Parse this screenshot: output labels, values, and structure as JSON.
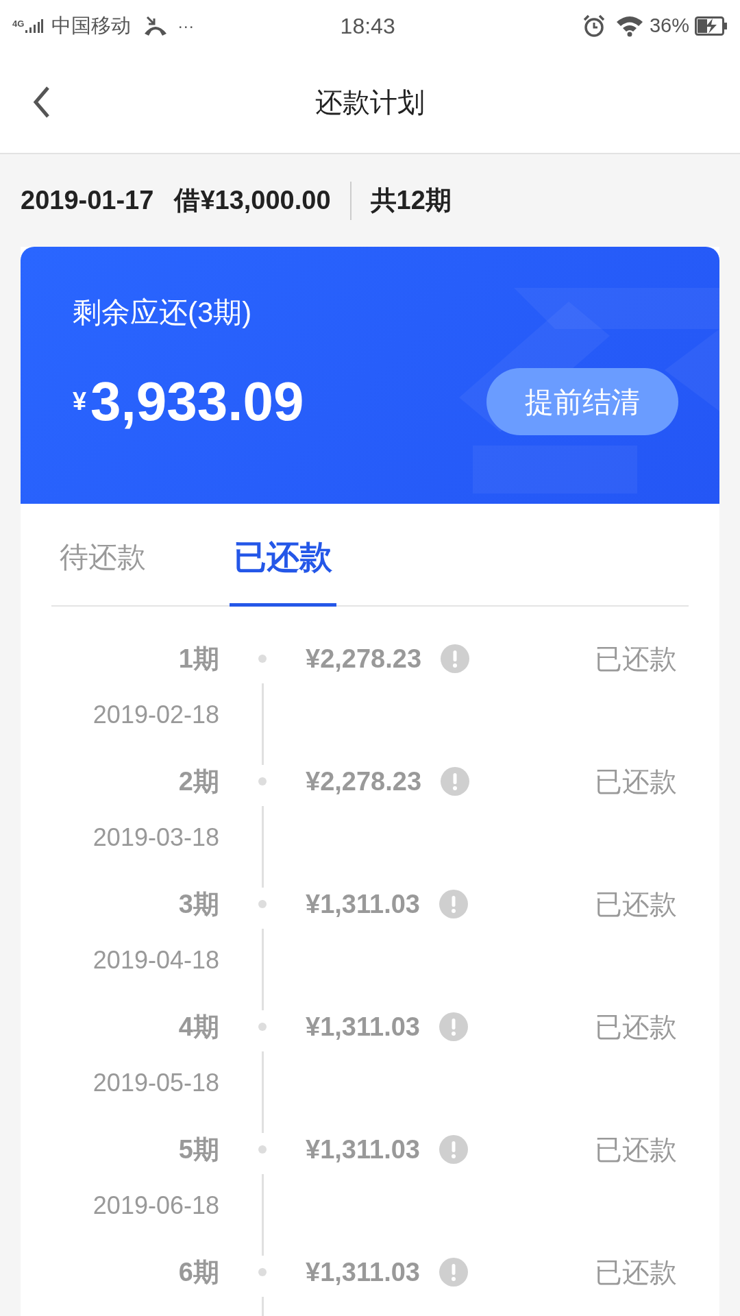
{
  "status_bar": {
    "network": "4G",
    "carrier": "中国移动",
    "more": "···",
    "time": "18:43",
    "battery": "36%"
  },
  "nav": {
    "title": "还款计划"
  },
  "summary": {
    "date": "2019-01-17",
    "amount": "借¥13,000.00",
    "periods": "共12期"
  },
  "card": {
    "label": "剩余应还(3期)",
    "currency": "¥",
    "amount": "3,933.09",
    "button": "提前结清"
  },
  "tabs": [
    {
      "label": "待还款",
      "selected": false
    },
    {
      "label": "已还款",
      "selected": true
    }
  ],
  "rows": [
    {
      "period": "1期",
      "date": "2019-02-18",
      "amount": "¥2,278.23",
      "status": "已还款"
    },
    {
      "period": "2期",
      "date": "2019-03-18",
      "amount": "¥2,278.23",
      "status": "已还款"
    },
    {
      "period": "3期",
      "date": "2019-04-18",
      "amount": "¥1,311.03",
      "status": "已还款"
    },
    {
      "period": "4期",
      "date": "2019-05-18",
      "amount": "¥1,311.03",
      "status": "已还款"
    },
    {
      "period": "5期",
      "date": "2019-06-18",
      "amount": "¥1,311.03",
      "status": "已还款"
    },
    {
      "period": "6期",
      "amount": "¥1,311.03",
      "status": "已还款"
    }
  ]
}
